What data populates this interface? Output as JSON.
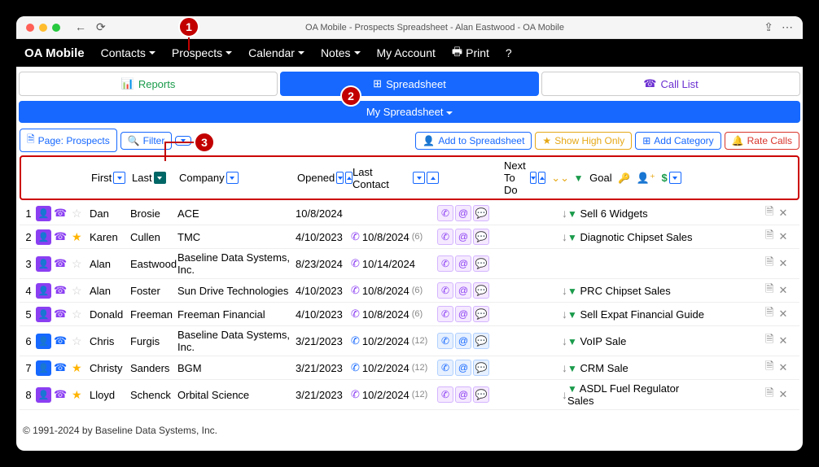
{
  "window": {
    "title": "OA Mobile - Prospects Spreadsheet - Alan Eastwood - OA Mobile"
  },
  "brand": "OA Mobile",
  "menu": [
    "Contacts",
    "Prospects",
    "Calendar",
    "Notes",
    "My Account",
    "Print",
    "?"
  ],
  "tabs": {
    "reports": "Reports",
    "spreadsheet": "Spreadsheet",
    "calllist": "Call List"
  },
  "subbar": "My Spreadsheet",
  "toolbar": {
    "page": "Page: Prospects",
    "filter": "Filter",
    "add": "Add to Spreadsheet",
    "showhigh": "Show High Only",
    "addcat": "Add Category",
    "rate": "Rate Calls"
  },
  "headers": {
    "first": "First",
    "last": "Last",
    "company": "Company",
    "opened": "Opened",
    "lastcontact": "Last Contact",
    "nexttodo": "Next To Do",
    "goal": "Goal"
  },
  "steps": {
    "s1": "1",
    "s2": "2",
    "s3": "3"
  },
  "rows": [
    {
      "idx": "1",
      "color": "purple",
      "phone_color": "purple",
      "star": false,
      "first": "Dan",
      "last": "Brosie",
      "company": "ACE",
      "opened": "10/8/2024",
      "contact": "",
      "count": "",
      "act": "purple",
      "arrow": "down",
      "goal": "Sell 6 Widgets"
    },
    {
      "idx": "2",
      "color": "purple",
      "phone_color": "purple",
      "star": true,
      "first": "Karen",
      "last": "Cullen",
      "company": "TMC",
      "opened": "4/10/2023",
      "contact": "10/8/2024",
      "count": "(6)",
      "act": "purple",
      "arrow": "down",
      "goal": "Diagnotic Chipset Sales"
    },
    {
      "idx": "3",
      "color": "purple",
      "phone_color": "purple",
      "star": false,
      "first": "Alan",
      "last": "Eastwood",
      "company": "Baseline Data Systems, Inc.",
      "opened": "8/23/2024",
      "contact": "10/14/2024",
      "count": "",
      "act": "purple",
      "arrow": "",
      "goal": ""
    },
    {
      "idx": "4",
      "color": "purple",
      "phone_color": "purple",
      "star": false,
      "first": "Alan",
      "last": "Foster",
      "company": "Sun Drive Technologies",
      "opened": "4/10/2023",
      "contact": "10/8/2024",
      "count": "(6)",
      "act": "purple",
      "arrow": "down",
      "goal": "PRC Chipset Sales"
    },
    {
      "idx": "5",
      "color": "purple",
      "phone_color": "purple",
      "star": false,
      "first": "Donald",
      "last": "Freeman",
      "company": "Freeman Financial",
      "opened": "4/10/2023",
      "contact": "10/8/2024",
      "count": "(6)",
      "act": "purple",
      "arrow": "down",
      "goal": "Sell Expat Financial Guide"
    },
    {
      "idx": "6",
      "color": "blue",
      "phone_color": "blue",
      "star": false,
      "first": "Chris",
      "last": "Furgis",
      "company": "Baseline Data Systems, Inc.",
      "opened": "3/21/2023",
      "contact": "10/2/2024",
      "count": "(12)",
      "act": "blue",
      "arrow": "down",
      "goal": "VoIP Sale"
    },
    {
      "idx": "7",
      "color": "blue",
      "phone_color": "blue",
      "star": true,
      "first": "Christy",
      "last": "Sanders",
      "company": "BGM",
      "opened": "3/21/2023",
      "contact": "10/2/2024",
      "count": "(12)",
      "act": "blue",
      "arrow": "down",
      "goal": "CRM Sale"
    },
    {
      "idx": "8",
      "color": "purple",
      "phone_color": "purple",
      "star": true,
      "first": "Lloyd",
      "last": "Schenck",
      "company": "Orbital Science",
      "opened": "3/21/2023",
      "contact": "10/2/2024",
      "count": "(12)",
      "act": "purple",
      "arrow": "down",
      "goal": "ASDL Fuel Regulator Sales"
    }
  ],
  "footer": "© 1991-2024 by Baseline Data Systems, Inc."
}
